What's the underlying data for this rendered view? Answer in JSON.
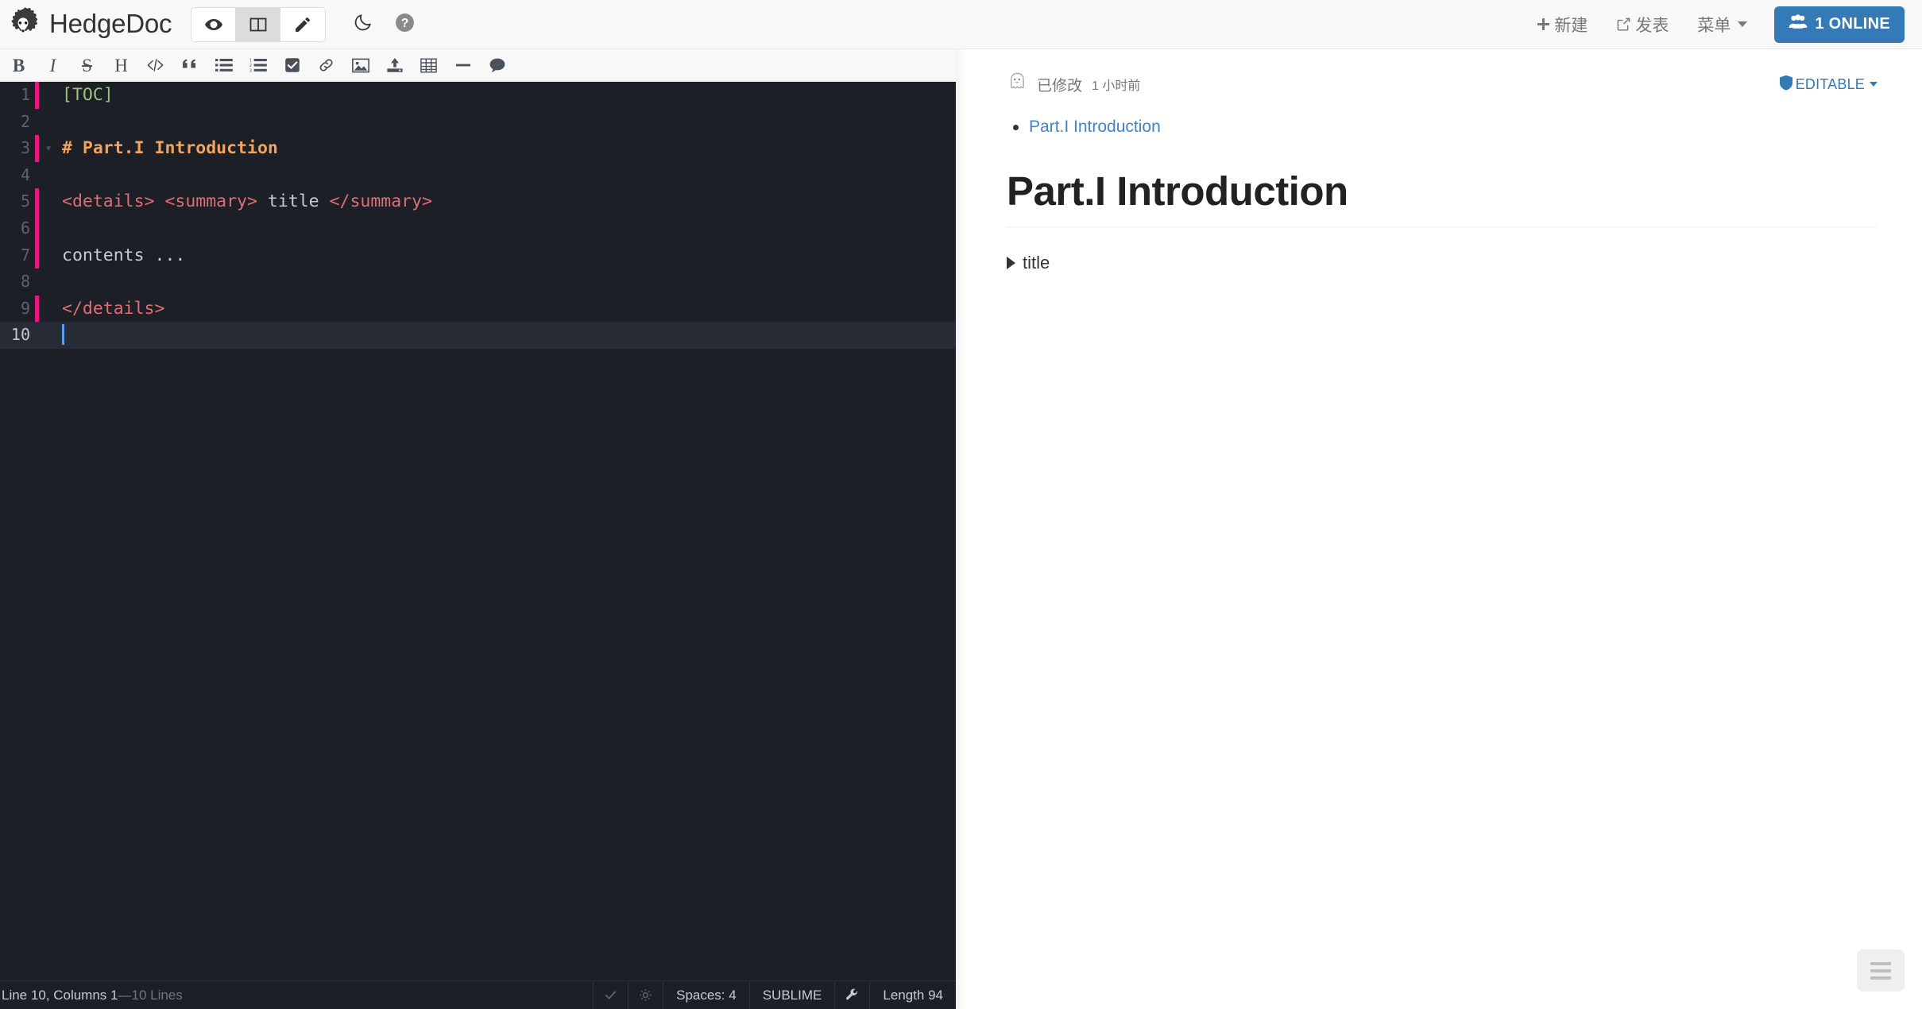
{
  "navbar": {
    "brand": "HedgeDoc",
    "logo_icon": "hedgehog-logo",
    "modes": [
      {
        "id": "view",
        "icon": "eye-icon",
        "label": "View",
        "active": false
      },
      {
        "id": "both",
        "icon": "columns-icon",
        "label": "Both",
        "active": true
      },
      {
        "id": "edit",
        "icon": "pencil-icon",
        "label": "Edit",
        "active": false
      }
    ],
    "night_icon": "moon-icon",
    "help_icon": "question-circle-icon",
    "new_label": "新建",
    "new_icon": "plus-icon",
    "publish_label": "发表",
    "publish_icon": "share-square-icon",
    "menu_label": "菜单",
    "online_label": "1 ONLINE",
    "online_icon": "users-icon",
    "online_color": "#337ab7"
  },
  "toolbar": {
    "items": [
      {
        "name": "bold",
        "glyph": "B",
        "kind": "text",
        "cls": "bold"
      },
      {
        "name": "italic",
        "glyph": "I",
        "kind": "text",
        "cls": "ital"
      },
      {
        "name": "strikethrough",
        "glyph": "S",
        "kind": "text",
        "cls": "strike"
      },
      {
        "name": "heading",
        "glyph": "H",
        "kind": "text",
        "cls": "head"
      },
      {
        "name": "code",
        "glyph": "</>",
        "kind": "svg"
      },
      {
        "name": "quote",
        "glyph": "“",
        "kind": "svg"
      },
      {
        "name": "unordered-list",
        "glyph": "",
        "kind": "svg"
      },
      {
        "name": "ordered-list",
        "glyph": "",
        "kind": "svg"
      },
      {
        "name": "check-list",
        "glyph": "",
        "kind": "svg"
      },
      {
        "name": "link",
        "glyph": "",
        "kind": "svg"
      },
      {
        "name": "image",
        "glyph": "",
        "kind": "svg"
      },
      {
        "name": "upload",
        "glyph": "",
        "kind": "svg"
      },
      {
        "name": "table",
        "glyph": "",
        "kind": "svg"
      },
      {
        "name": "horizontal-rule",
        "glyph": "",
        "kind": "svg"
      },
      {
        "name": "comment",
        "glyph": "",
        "kind": "svg"
      }
    ]
  },
  "editor": {
    "theme_bg": "#1c1f26",
    "active_line": 10,
    "lines": [
      {
        "n": "1",
        "mark": true,
        "fold": "",
        "tokens": [
          {
            "t": "[TOC]",
            "c": "tok-toc"
          }
        ]
      },
      {
        "n": "2",
        "mark": false,
        "fold": "",
        "tokens": []
      },
      {
        "n": "3",
        "mark": true,
        "fold": "v",
        "tokens": [
          {
            "t": "# Part.I Introduction",
            "c": "tok-head"
          }
        ]
      },
      {
        "n": "4",
        "mark": false,
        "fold": "",
        "tokens": []
      },
      {
        "n": "5",
        "mark": true,
        "fold": "",
        "tokens": [
          {
            "t": "<details> <summary>",
            "c": "tok-tag"
          },
          {
            "t": " title ",
            "c": "tok-plain"
          },
          {
            "t": "</summary>",
            "c": "tok-tag"
          }
        ]
      },
      {
        "n": "6",
        "mark": true,
        "fold": "",
        "tokens": []
      },
      {
        "n": "7",
        "mark": true,
        "fold": "",
        "tokens": [
          {
            "t": "contents ...",
            "c": "tok-plain"
          }
        ]
      },
      {
        "n": "8",
        "mark": false,
        "fold": "",
        "tokens": []
      },
      {
        "n": "9",
        "mark": true,
        "fold": "",
        "tokens": [
          {
            "t": "</details>",
            "c": "tok-tag"
          }
        ]
      },
      {
        "n": "10",
        "mark": false,
        "fold": "",
        "tokens": [],
        "cursor": true
      }
    ]
  },
  "statusbar": {
    "position": "Line 10, Columns 1",
    "separator": " — ",
    "total_lines": "10 Lines",
    "check_icon": "check-icon",
    "spinner_icon": "gear-icon",
    "indentation": "Spaces: 4",
    "keymap": "SUBLIME",
    "wrench_icon": "wrench-icon",
    "length": "Length 94"
  },
  "preview": {
    "modified_icon": "ghost-avatar-icon",
    "modified_text": "已修改",
    "modified_time": "1 小时前",
    "permission_icon": "shield-icon",
    "permission_label": "EDITABLE",
    "permission_color": "#337ab7",
    "toc": [
      {
        "label": "Part.I Introduction"
      }
    ],
    "heading": "Part.I Introduction",
    "details_summary": "title",
    "fab_icon": "hamburger-menu-icon"
  }
}
